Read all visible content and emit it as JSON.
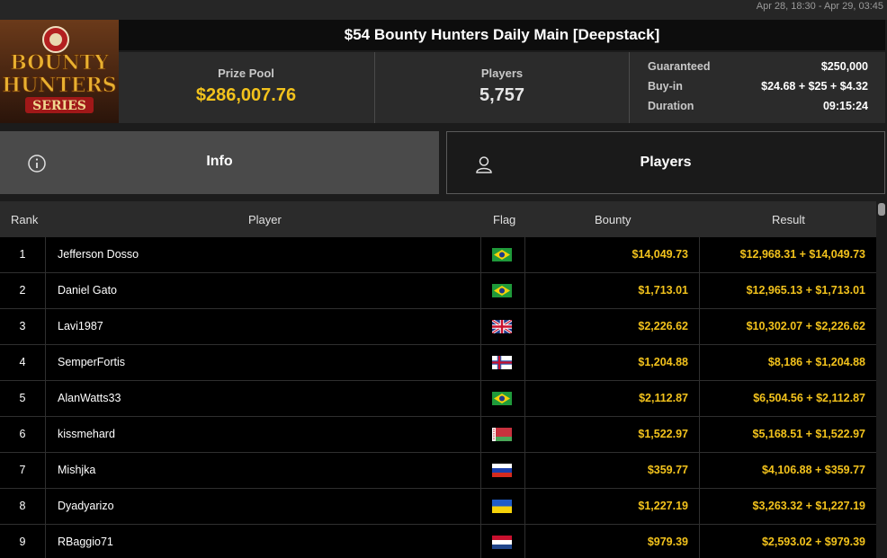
{
  "date_range": "Apr 28, 18:30 - Apr 29, 03:45",
  "logo": {
    "line1": "BOUNTY",
    "line2": "HUNTERS",
    "line3": "SERIES"
  },
  "title": "$54 Bounty Hunters Daily Main [Deepstack]",
  "stats": {
    "prize_pool_label": "Prize Pool",
    "prize_pool": "$286,007.76",
    "players_label": "Players",
    "players": "5,757",
    "guaranteed_label": "Guaranteed",
    "guaranteed": "$250,000",
    "buyin_label": "Buy-in",
    "buyin": "$24.68 + $25 + $4.32",
    "duration_label": "Duration",
    "duration": "09:15:24"
  },
  "tabs": {
    "info": "Info",
    "players": "Players"
  },
  "columns": {
    "rank": "Rank",
    "player": "Player",
    "flag": "Flag",
    "bounty": "Bounty",
    "result": "Result"
  },
  "rows": [
    {
      "rank": "1",
      "player": "Jefferson Dosso",
      "flag": "brazil",
      "bounty": "$14,049.73",
      "result": "$12,968.31 + $14,049.73"
    },
    {
      "rank": "2",
      "player": "Daniel Gato",
      "flag": "brazil",
      "bounty": "$1,713.01",
      "result": "$12,965.13 + $1,713.01"
    },
    {
      "rank": "3",
      "player": "Lavi1987",
      "flag": "united-kingdom",
      "bounty": "$2,226.62",
      "result": "$10,302.07 + $2,226.62"
    },
    {
      "rank": "4",
      "player": "SemperFortis",
      "flag": "faroe-islands",
      "bounty": "$1,204.88",
      "result": "$8,186 + $1,204.88"
    },
    {
      "rank": "5",
      "player": "AlanWatts33",
      "flag": "brazil",
      "bounty": "$2,112.87",
      "result": "$6,504.56 + $2,112.87"
    },
    {
      "rank": "6",
      "player": "kissmehard",
      "flag": "belarus",
      "bounty": "$1,522.97",
      "result": "$5,168.51 + $1,522.97"
    },
    {
      "rank": "7",
      "player": "Mishjka",
      "flag": "russia",
      "bounty": "$359.77",
      "result": "$4,106.88 + $359.77"
    },
    {
      "rank": "8",
      "player": "Dyadyarizo",
      "flag": "ukraine",
      "bounty": "$1,227.19",
      "result": "$3,263.32 + $1,227.19"
    },
    {
      "rank": "9",
      "player": "RBaggio71",
      "flag": "netherlands",
      "bounty": "$979.39",
      "result": "$2,593.02 + $979.39"
    }
  ],
  "colors": {
    "accent": "#f2c21c",
    "row_bg": "#000000",
    "header_bg": "#2b2b2b"
  }
}
